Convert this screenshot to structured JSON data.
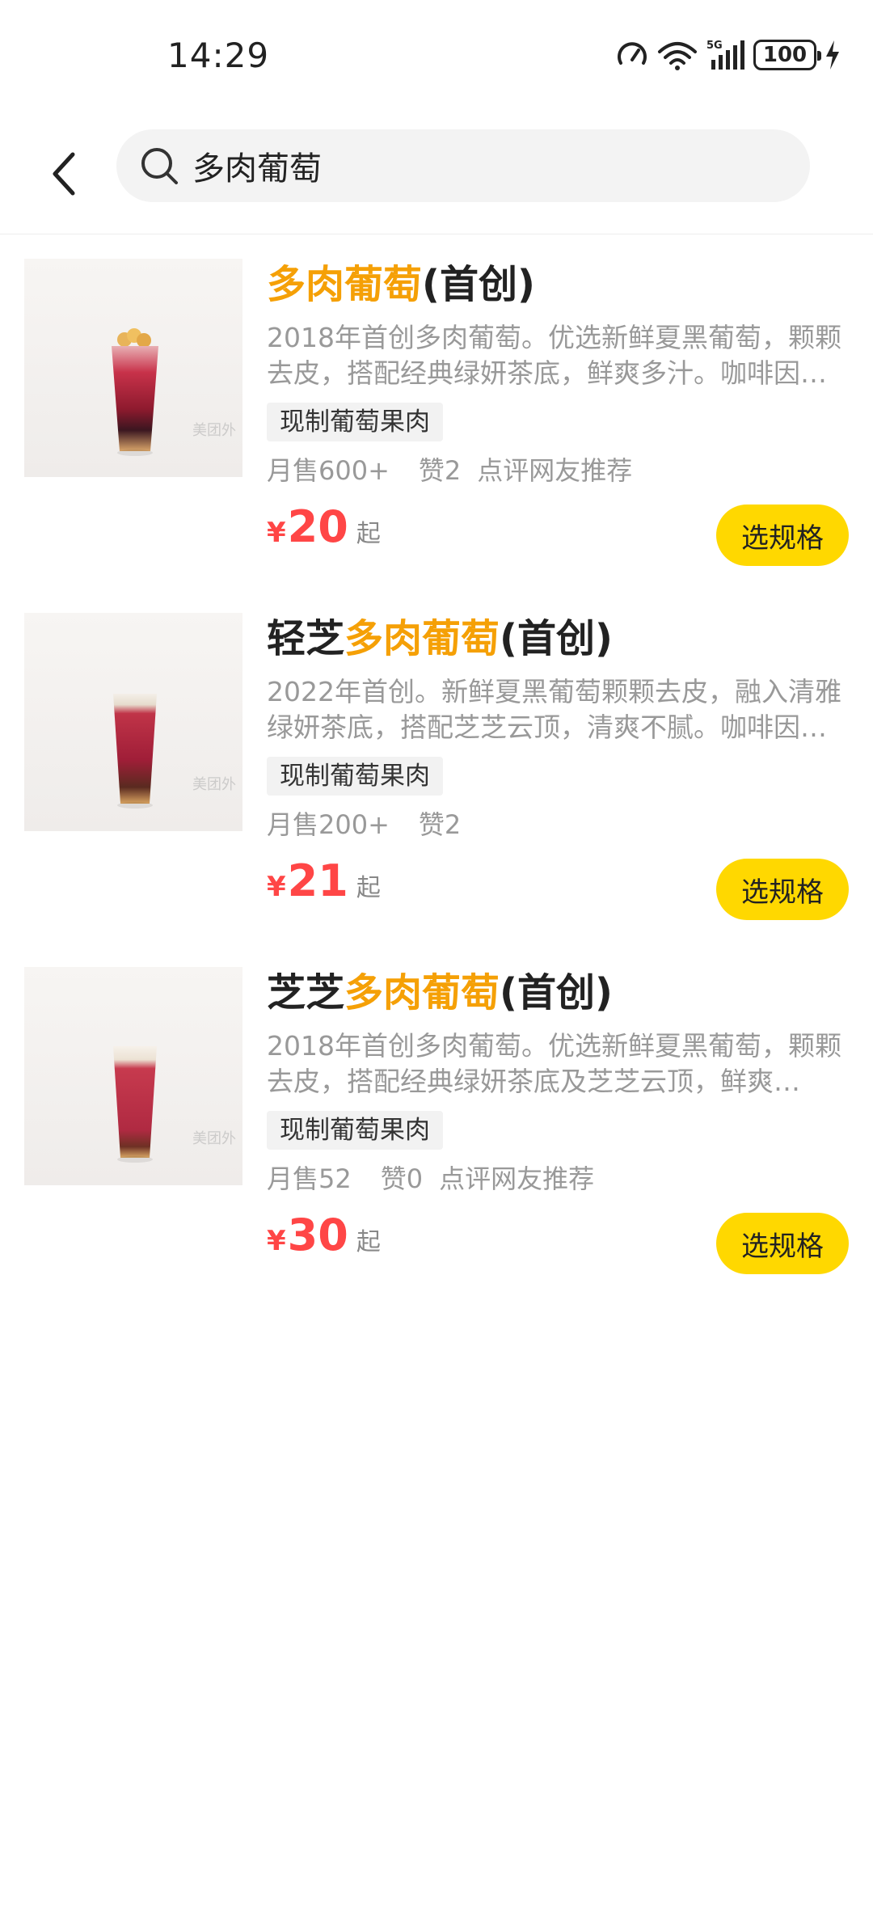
{
  "status_bar": {
    "time": "14:29",
    "battery": "100",
    "network": "5G",
    "wifi_badge": "6"
  },
  "search": {
    "query": "多肉葡萄"
  },
  "products": [
    {
      "title_before": "",
      "title_highlight": "多肉葡萄",
      "title_after": "(首创)",
      "description": "2018年首创多肉葡萄。优选新鲜夏黑葡萄，颗颗去皮，搭配经典绿妍茶底，鲜爽多汁。咖啡因…",
      "tag": "现制葡萄果肉",
      "monthly_sales": "月售600+",
      "likes": "赞2",
      "recommend": "点评网友推荐",
      "currency": "¥",
      "price": "20",
      "price_suffix": "起",
      "button_label": "选规格"
    },
    {
      "title_before": "轻芝",
      "title_highlight": "多肉葡萄",
      "title_after": "(首创)",
      "description": "2022年首创。新鲜夏黑葡萄颗颗去皮，融入清雅绿妍茶底，搭配芝芝云顶，清爽不腻。咖啡因…",
      "tag": "现制葡萄果肉",
      "monthly_sales": "月售200+",
      "likes": "赞2",
      "recommend": "",
      "currency": "¥",
      "price": "21",
      "price_suffix": "起",
      "button_label": "选规格"
    },
    {
      "title_before": "芝芝",
      "title_highlight": "多肉葡萄",
      "title_after": "(首创)",
      "description": "2018年首创多肉葡萄。优选新鲜夏黑葡萄，颗颗去皮，搭配经典绿妍茶底及芝芝云顶，鲜爽…",
      "tag": "现制葡萄果肉",
      "monthly_sales": "月售52",
      "likes": "赞0",
      "recommend": "点评网友推荐",
      "currency": "¥",
      "price": "30",
      "price_suffix": "起",
      "button_label": "选规格"
    }
  ],
  "colors": {
    "highlight": "#f5a006",
    "price": "#ff4646",
    "button": "#ffd800"
  }
}
